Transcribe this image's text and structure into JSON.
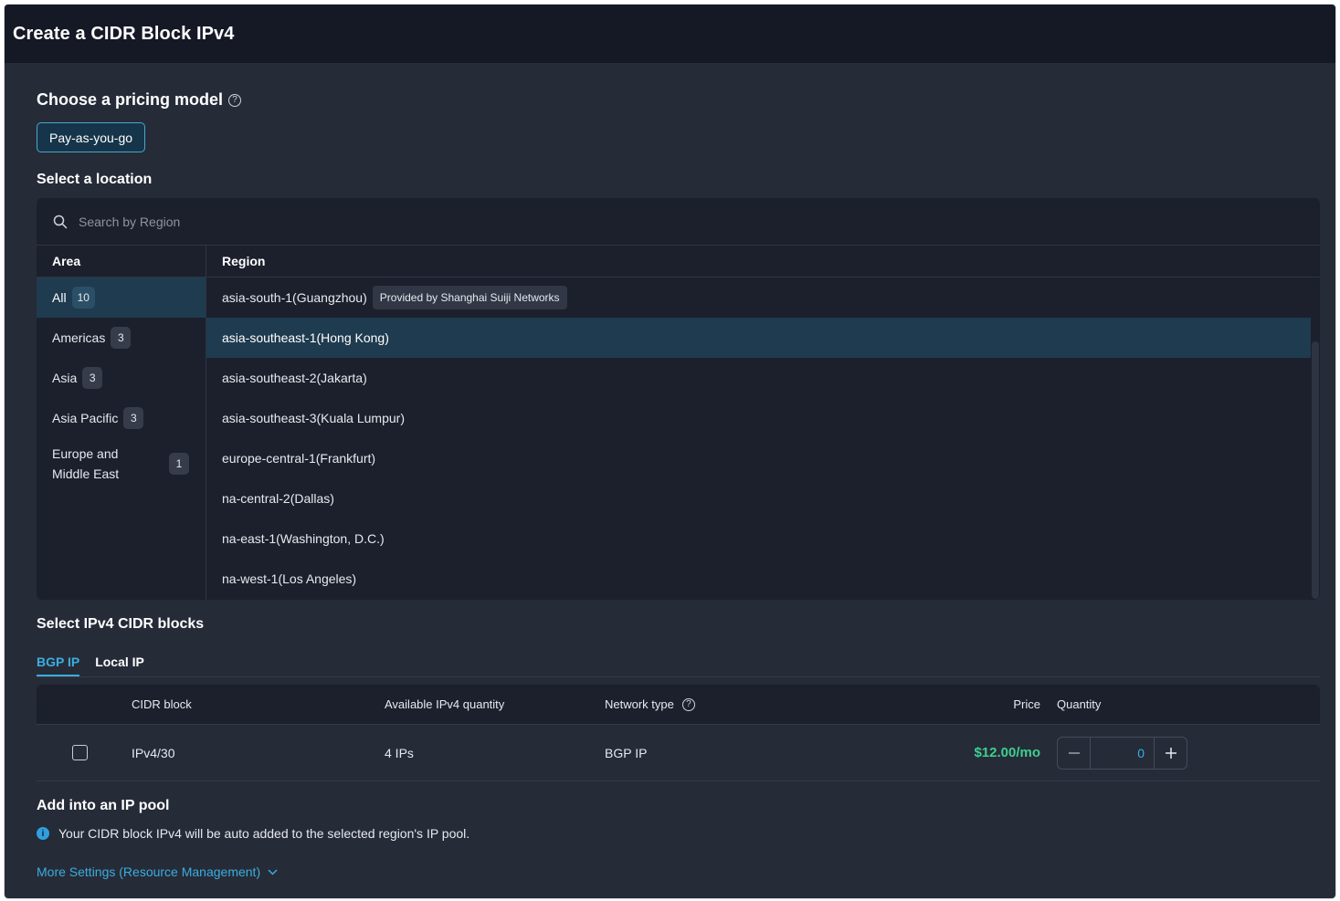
{
  "window": {
    "title": "Create a CIDR Block IPv4"
  },
  "pricing": {
    "title": "Choose a pricing model",
    "help_glyph": "?",
    "option": "Pay-as-you-go"
  },
  "location": {
    "title": "Select a location",
    "search_placeholder": "Search by Region",
    "area_header": "Area",
    "region_header": "Region",
    "areas": [
      {
        "label": "All",
        "count": "10",
        "active": true
      },
      {
        "label": "Americas",
        "count": "3"
      },
      {
        "label": "Asia",
        "count": "3"
      },
      {
        "label": "Asia Pacific",
        "count": "3"
      },
      {
        "label": "Europe and Middle East",
        "count": "1"
      }
    ],
    "regions": [
      {
        "label": "asia-south-1(Guangzhou)",
        "tag": "Provided by Shanghai Suiji Networks"
      },
      {
        "label": "asia-southeast-1(Hong Kong)",
        "selected": true
      },
      {
        "label": "asia-southeast-2(Jakarta)"
      },
      {
        "label": "asia-southeast-3(Kuala Lumpur)"
      },
      {
        "label": "europe-central-1(Frankfurt)"
      },
      {
        "label": "na-central-2(Dallas)"
      },
      {
        "label": "na-east-1(Washington, D.C.)"
      },
      {
        "label": "na-west-1(Los Angeles)"
      }
    ]
  },
  "cidr": {
    "title": "Select IPv4 CIDR blocks",
    "tabs": [
      {
        "label": "BGP IP",
        "active": true
      },
      {
        "label": "Local IP"
      }
    ],
    "headers": {
      "cidr_block": "CIDR block",
      "available": "Available IPv4 quantity",
      "network_type": "Network type",
      "price": "Price",
      "quantity": "Quantity"
    },
    "rows": [
      {
        "cidr_block": "IPv4/30",
        "available": "4 IPs",
        "network_type": "BGP IP",
        "price": "$12.00/mo",
        "quantity": "0",
        "checked": false
      }
    ]
  },
  "pool": {
    "title": "Add into an IP pool",
    "info_glyph": "i",
    "info": "Your CIDR block IPv4 will be auto added to the selected region's IP pool.",
    "more_link": "More Settings (Resource Management)"
  },
  "colors": {
    "background": "#262b38",
    "titlebar": "#151925",
    "panel": "#1c202c",
    "accent": "#3aaee0",
    "selected_row": "#1f3b4f",
    "price": "#3fcf8e"
  },
  "icons": {
    "search": "search-icon",
    "help": "help-circle-icon",
    "info": "info-circle-icon",
    "chevron": "chevron-down-icon",
    "minus": "minus-icon",
    "plus": "plus-icon"
  }
}
